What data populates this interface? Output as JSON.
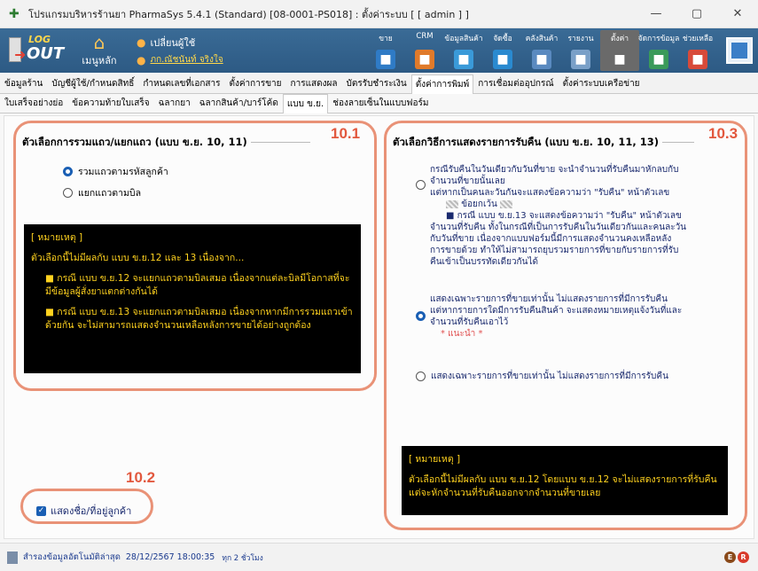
{
  "window": {
    "title": "โปรแกรมบริหารร้านยา PharmaSys 5.4.1 (Standard) [08-0001-PS018] : ตั้งค่าระบบ [ [ admin ] ]",
    "minimize": "—",
    "maximize": "▢",
    "close": "✕"
  },
  "toolbar": {
    "logout_top": "LOG",
    "logout_bottom": "OUT",
    "home_label": "เมนูหลัก",
    "change_user_label": "เปลี่ยนผู้ใช้",
    "user_name": "ภก.ณัชนันท์ จริงใจ",
    "tools": [
      {
        "label": "ขาย",
        "icon": "sale-icon"
      },
      {
        "label": "CRM",
        "icon": "crm-icon"
      },
      {
        "label": "ข้อมูลสินค้า",
        "icon": "product-info-icon"
      },
      {
        "label": "จัดซื้อ",
        "icon": "purchase-icon"
      },
      {
        "label": "คลังสินค้า",
        "icon": "warehouse-icon"
      },
      {
        "label": "รายงาน",
        "icon": "report-icon"
      },
      {
        "label": "ตั้งค่า",
        "icon": "settings-icon"
      },
      {
        "label": "จัดการข้อมูล",
        "icon": "data-manage-icon"
      },
      {
        "label": "ช่วยเหลือ",
        "icon": "help-icon"
      }
    ]
  },
  "tabs_primary": [
    "ข้อมูลร้าน",
    "บัญชีผู้ใช้/กำหนดสิทธิ์",
    "กำหนดเลขที่เอกสาร",
    "ตั้งค่าการขาย",
    "การแสดงผล",
    "บัตรรับชำระเงิน",
    "ตั้งค่าการพิมพ์",
    "การเชื่อมต่ออุปกรณ์",
    "ตั้งค่าระบบเครือข่าย"
  ],
  "tabs_primary_active": 6,
  "tabs_secondary": [
    "ใบเสร็จอย่างย่อ",
    "ข้อความท้ายใบเสร็จ",
    "ฉลากยา",
    "ฉลากสินค้า/บาร์โค้ด",
    "แบบ ข.ย.",
    "ช่องลายเซ็นในแบบฟอร์ม"
  ],
  "tabs_secondary_active": 4,
  "annotations": {
    "a1": "10.1",
    "a2": "10.2",
    "a3": "10.3"
  },
  "left_group": {
    "title": "ตัวเลือกการรวมแถว/แยกแถว (แบบ ข.ย. 10, 11)",
    "option1": "รวมแถวตามรหัสลูกค้า",
    "option2": "แยกแถวตามบิล",
    "selected": 0,
    "note": {
      "header": "[ หมายเหตุ ]",
      "p1": "ตัวเลือกนี้ไม่มีผลกับ แบบ ข.ย.12 และ 13 เนื่องจาก...",
      "p2": "■ กรณี แบบ ข.ย.12 จะแยกแถวตามบิลเสมอ เนื่องจากแต่ละบิลมีโอกาสที่จะมีข้อมูลผู้สั่งยาแตกต่างกันได้",
      "p3": "■ กรณี แบบ ข.ย.13 จะแยกแถวตามบิลเสมอ เนื่องจากหากมีการรวมแถวเข้าด้วยกัน จะไม่สามารถแสดงจำนวนเหลือหลังการขายได้อย่างถูกต้อง"
    }
  },
  "show_customer": {
    "label": "แสดงชื่อ/ที่อยู่ลูกค้า",
    "checked": true
  },
  "right_group": {
    "title": "ตัวเลือกวิธีการแสดงรายการรับคืน (แบบ ข.ย. 10, 11, 13)",
    "opt1_l1": "กรณีรับคืนในวันเดียวกับวันที่ขาย จะนำจำนวนที่รับคืนมาหักลบกับ",
    "opt1_l2": "จำนวนที่ขายนั้นเลย",
    "opt1_l3": "แต่หากเป็นคนละวันกันจะแสดงข้อความว่า \"รับคืน\" หน้าตัวเลข",
    "opt1_l4": "ข้อยกเว้น",
    "opt1_l5": "■ กรณี แบบ ข.ย.13 จะแสดงข้อความว่า \"รับคืน\" หน้าตัวเลข",
    "opt1_l6": "จำนวนที่รับคืน ทั้งในกรณีที่เป็นการรับคืนในวันเดียวกันและคนละวัน",
    "opt1_l7": "กับวันที่ขาย เนื่องจากแบบฟอร์มนี้มีการแสดงจำนวนคงเหลือหลัง",
    "opt1_l8": "การขายด้วย ทำให้ไม่สามารถยุบรวมรายการที่ขายกับรายการที่รับ",
    "opt1_l9": "คืนเข้าเป็นบรรทัดเดียวกันได้",
    "opt2_l1": "แสดงเฉพาะรายการที่ขายเท่านั้น ไม่แสดงรายการที่มีการรับคืน",
    "opt2_l2": "แต่หากรายการใดมีการรับคืนสินค้า จะแสดงหมายเหตุแจ้งวันที่และ",
    "opt2_l3": "จำนวนที่รับคืนเอาไว้",
    "opt2_rec": "* แนะนำ *",
    "opt3": "แสดงเฉพาะรายการที่ขายเท่านั้น ไม่แสดงรายการที่มีการรับคืน",
    "selected": 1,
    "note": {
      "header": "[ หมายเหตุ ]",
      "p1": "ตัวเลือกนี้ไม่มีผลกับ แบบ ข.ย.12 โดยแบบ ข.ย.12 จะไม่แสดงรายการที่รับคืน แต่จะหักจำนวนที่รับคืนออกจากจำนวนที่ขายเลย"
    }
  },
  "status": {
    "backup": "สำรองข้อมูลอัตโนมัติล่าสุด",
    "datetime": "28/12/2567 18:00:35",
    "interval": "ทุก 2 ชั่วโมง",
    "badge1": "E",
    "badge2": "R"
  },
  "colors": {
    "accent": "#1a5fb4",
    "annotation": "#e2583e",
    "note_bg": "#000000",
    "note_fg": "#ffd21f",
    "toolbar": "#2d5a84"
  }
}
